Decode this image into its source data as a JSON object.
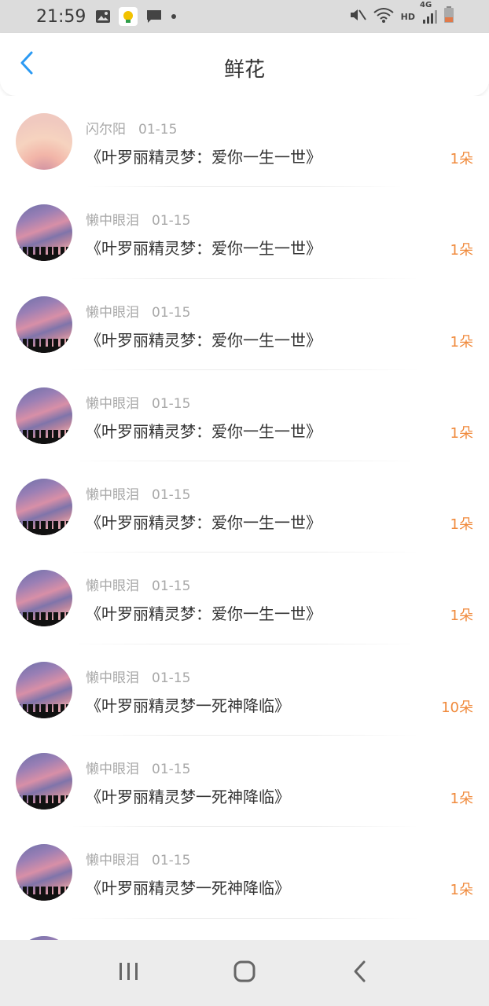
{
  "status_bar": {
    "time": "21:59",
    "network": "HD",
    "signal_label": "4G"
  },
  "header": {
    "title": "鲜花",
    "back_icon": "chevron-left-icon"
  },
  "colors": {
    "accent": "#2b9af3",
    "count": "#f08a3c",
    "meta": "#a8a8a8"
  },
  "items": [
    {
      "name": "闪尔阳",
      "date": "01-15",
      "gift": "《叶罗丽精灵梦：爱你一生一世》",
      "count": "1朵"
    },
    {
      "name": "懒中眼泪",
      "date": "01-15",
      "gift": "《叶罗丽精灵梦：爱你一生一世》",
      "count": "1朵"
    },
    {
      "name": "懒中眼泪",
      "date": "01-15",
      "gift": "《叶罗丽精灵梦：爱你一生一世》",
      "count": "1朵"
    },
    {
      "name": "懒中眼泪",
      "date": "01-15",
      "gift": "《叶罗丽精灵梦：爱你一生一世》",
      "count": "1朵"
    },
    {
      "name": "懒中眼泪",
      "date": "01-15",
      "gift": "《叶罗丽精灵梦：爱你一生一世》",
      "count": "1朵"
    },
    {
      "name": "懒中眼泪",
      "date": "01-15",
      "gift": "《叶罗丽精灵梦：爱你一生一世》",
      "count": "1朵"
    },
    {
      "name": "懒中眼泪",
      "date": "01-15",
      "gift": "《叶罗丽精灵梦一死神降临》",
      "count": "10朵"
    },
    {
      "name": "懒中眼泪",
      "date": "01-15",
      "gift": "《叶罗丽精灵梦一死神降临》",
      "count": "1朵"
    },
    {
      "name": "懒中眼泪",
      "date": "01-15",
      "gift": "《叶罗丽精灵梦一死神降临》",
      "count": "1朵"
    }
  ],
  "nav": {
    "recents_icon": "recent-apps-icon",
    "home_icon": "home-icon",
    "back_icon": "back-icon"
  }
}
